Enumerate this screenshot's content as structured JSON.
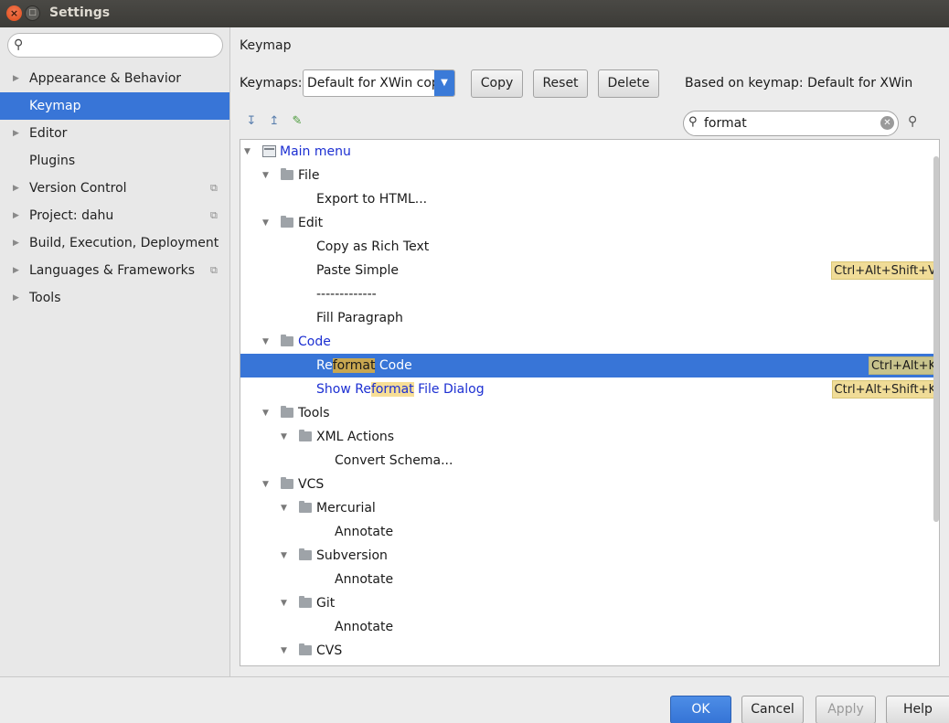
{
  "window": {
    "title": "Settings",
    "close_glyph": "×",
    "max_glyph": "□"
  },
  "sidebar": {
    "search": {
      "value": "",
      "placeholder": ""
    },
    "items": [
      {
        "label": "Appearance & Behavior",
        "expandable": true,
        "project": false,
        "selected": false
      },
      {
        "label": "Keymap",
        "expandable": false,
        "project": false,
        "selected": true
      },
      {
        "label": "Editor",
        "expandable": true,
        "project": false,
        "selected": false
      },
      {
        "label": "Plugins",
        "expandable": false,
        "project": false,
        "selected": false
      },
      {
        "label": "Version Control",
        "expandable": true,
        "project": true,
        "selected": false
      },
      {
        "label": "Project: dahu",
        "expandable": true,
        "project": true,
        "selected": false
      },
      {
        "label": "Build, Execution, Deployment",
        "expandable": true,
        "project": false,
        "selected": false
      },
      {
        "label": "Languages & Frameworks",
        "expandable": true,
        "project": true,
        "selected": false
      },
      {
        "label": "Tools",
        "expandable": true,
        "project": false,
        "selected": false
      }
    ]
  },
  "keymap": {
    "section_title": "Keymap",
    "keymaps_label": "Keymaps:",
    "selected_keymap": "Default for XWin copy",
    "copy_label": "Copy",
    "reset_label": "Reset",
    "delete_label": "Delete",
    "based_on": "Based on keymap: Default for XWin",
    "filter_value": "format"
  },
  "tree": [
    {
      "text": "Main menu",
      "depth": 0,
      "kind": "menu",
      "blue": true
    },
    {
      "text": "File",
      "depth": 1,
      "kind": "folder"
    },
    {
      "text": "Export to HTML...",
      "depth": 2,
      "kind": "action"
    },
    {
      "text": "Edit",
      "depth": 1,
      "kind": "folder"
    },
    {
      "text": "Copy as Rich Text",
      "depth": 2,
      "kind": "action"
    },
    {
      "text": "Paste Simple",
      "depth": 2,
      "kind": "action",
      "shortcut": "Ctrl+Alt+Shift+V"
    },
    {
      "text": "-------------",
      "depth": 2,
      "kind": "action"
    },
    {
      "text": "Fill Paragraph",
      "depth": 2,
      "kind": "action"
    },
    {
      "text": "Code",
      "depth": 1,
      "kind": "folder",
      "blue": true
    },
    {
      "pre": "Re",
      "hl": "format",
      "post": " Code",
      "depth": 2,
      "kind": "action",
      "selected": true,
      "shortcut": "Ctrl+Alt+K"
    },
    {
      "pre": "Show Re",
      "hl": "format",
      "post": " File Dialog",
      "depth": 2,
      "kind": "action",
      "blue": true,
      "shortcut": "Ctrl+Alt+Shift+K"
    },
    {
      "text": "Tools",
      "depth": 1,
      "kind": "folder"
    },
    {
      "text": "XML Actions",
      "depth": 2,
      "kind": "folder"
    },
    {
      "text": "Convert Schema...",
      "depth": 3,
      "kind": "action"
    },
    {
      "text": "VCS",
      "depth": 1,
      "kind": "folder"
    },
    {
      "text": "Mercurial",
      "depth": 2,
      "kind": "folder"
    },
    {
      "text": "Annotate",
      "depth": 3,
      "kind": "action"
    },
    {
      "text": "Subversion",
      "depth": 2,
      "kind": "folder"
    },
    {
      "text": "Annotate",
      "depth": 3,
      "kind": "action"
    },
    {
      "text": "Git",
      "depth": 2,
      "kind": "folder"
    },
    {
      "text": "Annotate",
      "depth": 3,
      "kind": "action"
    },
    {
      "text": "CVS",
      "depth": 2,
      "kind": "folder"
    }
  ],
  "footer": {
    "ok": "OK",
    "cancel": "Cancel",
    "apply": "Apply",
    "help": "Help"
  },
  "icons": {
    "expand_all": "expand-all-icon",
    "collapse_all": "collapse-all-icon",
    "edit": "pencil-icon",
    "find_shortcut": "find-by-shortcut-icon"
  },
  "colors": {
    "selection": "#3875d7",
    "highlight": "#f7de96",
    "shortcut_bg": "#f0dc97",
    "link_blue": "#1c2fd2"
  }
}
